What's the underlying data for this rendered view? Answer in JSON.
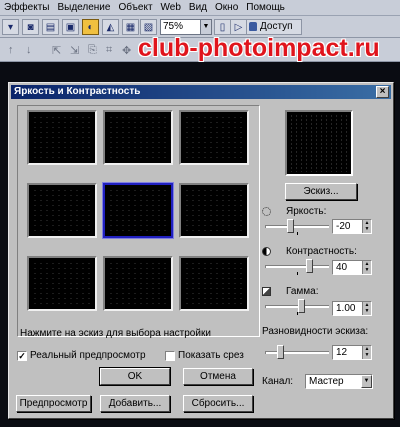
{
  "menu": [
    "Эффекты",
    "Выделение",
    "Объект",
    "Web",
    "Вид",
    "Окно",
    "Помощь"
  ],
  "toolbar": {
    "zoom": "75%",
    "access_label": "Доступ"
  },
  "watermark": "club-photoimpact.ru",
  "dialog": {
    "title": "Яркость и Контрастность",
    "close_glyph": "×",
    "hint": "Нажмите на эскиз для выбора настройки",
    "realtime_preview_label": "Реальный предпросмотр",
    "realtime_preview_checked": true,
    "show_slice_label": "Показать срез",
    "show_slice_checked": false,
    "ok_label": "OK",
    "cancel_label": "Отмена",
    "preview_label": "Предпросмотр",
    "add_label": "Добавить...",
    "reset_label": "Сбросить...",
    "sketch_button_label": "Эскиз...",
    "brightness": {
      "label": "Яркость:",
      "value": "-20"
    },
    "contrast": {
      "label": "Контрастность:",
      "value": "40"
    },
    "gamma": {
      "label": "Гамма:",
      "value": "1.00"
    },
    "variation": {
      "label": "Разновидности эскиза:",
      "value": "12"
    },
    "channel": {
      "label": "Канал:",
      "value": "Мастер"
    },
    "selected_thumbnail": 4
  },
  "colors": {
    "title_bar": "#0a246a",
    "watermark": "#e0141c",
    "dialog_bg": "#c0c0c0"
  }
}
